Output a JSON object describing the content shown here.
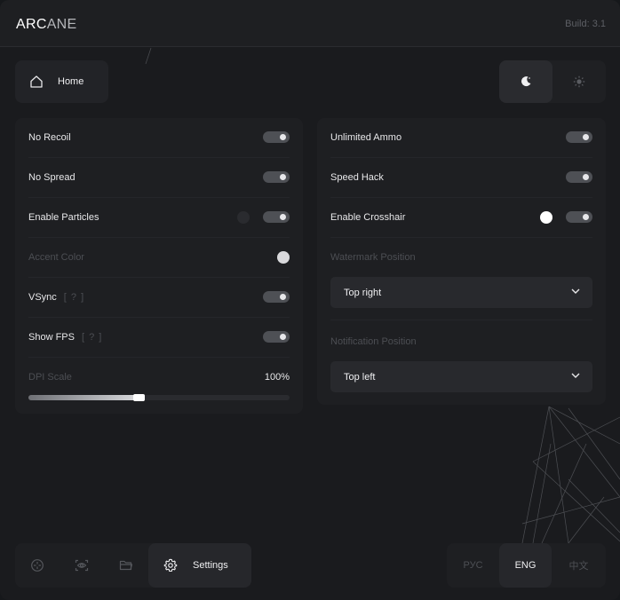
{
  "app": {
    "logo_bold": "ARC",
    "logo_light": "ANE",
    "build": "Build: 3.1"
  },
  "nav": {
    "home_label": "Home",
    "home_icon": "home-icon",
    "theme_options": [
      {
        "name": "dark",
        "icon": "moon-icon",
        "selected": true
      },
      {
        "name": "light",
        "icon": "sun-icon",
        "selected": false
      }
    ]
  },
  "left_panel": {
    "no_recoil": {
      "label": "No Recoil",
      "enabled": true
    },
    "no_spread": {
      "label": "No Spread",
      "enabled": true
    },
    "particles": {
      "label": "Enable Particles",
      "enabled": true,
      "color": "#2a2b2f"
    },
    "accent_color": {
      "label": "Accent Color",
      "color": "#d9d9dc"
    },
    "vsync": {
      "label": "VSync",
      "hint": "[ ? ]",
      "enabled": true
    },
    "show_fps": {
      "label": "Show FPS",
      "hint": "[ ? ]",
      "enabled": true
    },
    "dpi_scale": {
      "label": "DPI Scale",
      "value_text": "100%",
      "level": 0.4
    }
  },
  "right_panel": {
    "unlimited_ammo": {
      "label": "Unlimited Ammo",
      "enabled": true
    },
    "speed_hack": {
      "label": "Speed Hack",
      "enabled": true
    },
    "crosshair": {
      "label": "Enable Crosshair",
      "enabled": true,
      "color": "#ffffff"
    },
    "watermark": {
      "label": "Watermark Position",
      "value": "Top right"
    },
    "notification": {
      "label": "Notification Position",
      "value": "Top left"
    }
  },
  "bottom_nav": {
    "items": [
      {
        "icon": "crosshair-icon"
      },
      {
        "icon": "eye-icon"
      },
      {
        "icon": "folder-icon"
      }
    ],
    "settings_label": "Settings",
    "settings_icon": "gear-icon"
  },
  "languages": [
    {
      "label": "РУС",
      "active": false
    },
    {
      "label": "ENG",
      "active": true
    },
    {
      "label": "中文",
      "active": false
    }
  ]
}
